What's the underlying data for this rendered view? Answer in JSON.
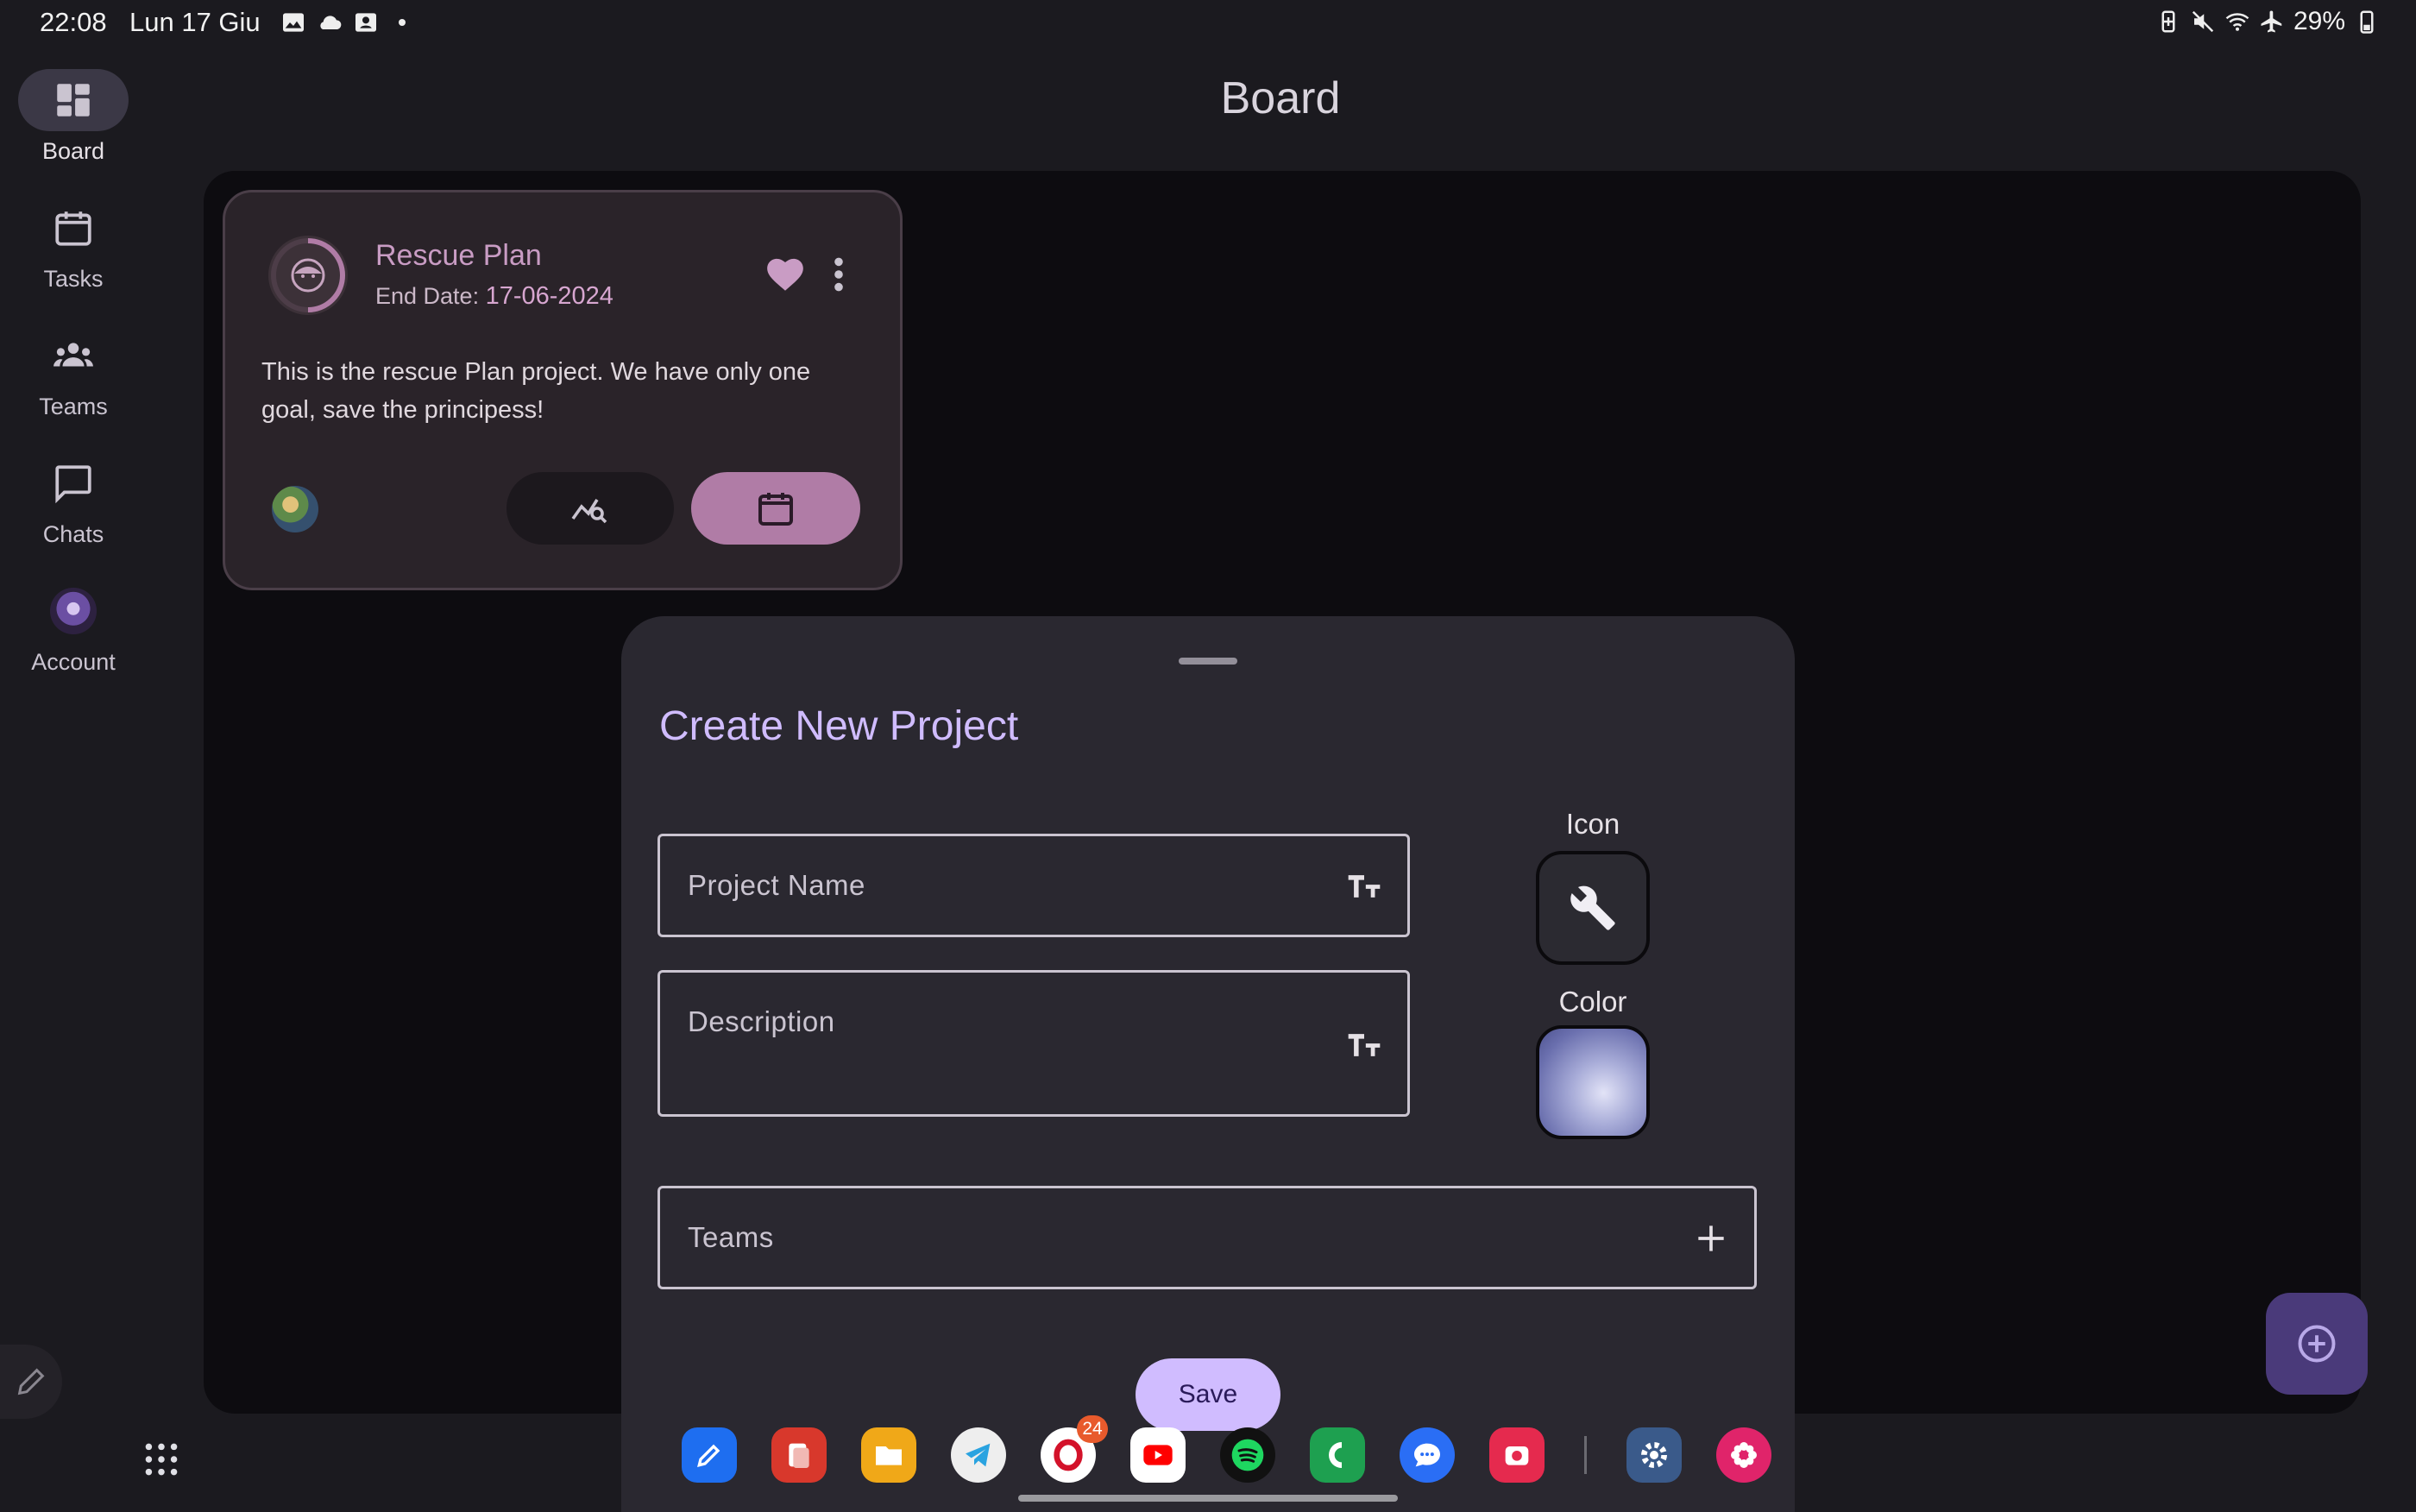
{
  "status_bar": {
    "time": "22:08",
    "date": "Lun 17 Giu",
    "battery": "29%",
    "notification_icons": [
      "image-icon",
      "cloud-icon",
      "contacts-icon",
      "dot-icon"
    ],
    "system_icons": [
      "battery-saver-icon",
      "mute-icon",
      "wifi-icon",
      "airplane-icon",
      "battery-icon"
    ]
  },
  "rail": {
    "items": [
      {
        "label": "Board",
        "icon": "dashboard-icon",
        "active": true
      },
      {
        "label": "Tasks",
        "icon": "calendar-icon"
      },
      {
        "label": "Teams",
        "icon": "groups-icon"
      },
      {
        "label": "Chats",
        "icon": "chat-icon"
      },
      {
        "label": "Account",
        "icon": "avatar"
      }
    ]
  },
  "page": {
    "title": "Board"
  },
  "project_card": {
    "title": "Rescue Plan",
    "end_date_label": "End Date:",
    "end_date": "17-06-2024",
    "description": "This is the rescue Plan project. We have only one goal, save the principess!",
    "favorite": true
  },
  "sheet": {
    "title": "Create New Project",
    "project_name_label": "Project Name",
    "description_label": "Description",
    "teams_label": "Teams",
    "icon_label": "Icon",
    "color_label": "Color",
    "selected_icon": "wrench-icon",
    "selected_color": "#8a8fc7",
    "save_label": "Save"
  },
  "dock": {
    "apps": [
      "notes-app",
      "flashcards-app",
      "files-app",
      "telegram-app",
      "opera-app",
      "youtube-app",
      "spotify-app",
      "phone-app",
      "messages-app",
      "camera-app",
      "settings-app",
      "flower-app"
    ],
    "opera_badge": "24"
  },
  "colors": {
    "accent": "#d0bcff",
    "card_accent": "#c99cc4",
    "background": "#1b1a1f"
  }
}
